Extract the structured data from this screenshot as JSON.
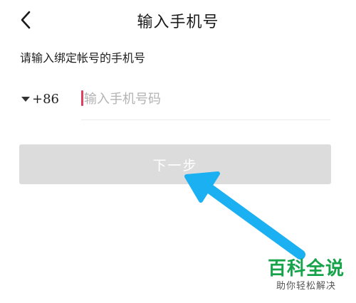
{
  "header": {
    "back_icon": "chevron-left-icon",
    "title": "输入手机号"
  },
  "form": {
    "subtitle": "请输入绑定帐号的手机号",
    "country_code": "+86",
    "country_dropdown_icon": "caret-down-icon",
    "phone_value": "",
    "phone_placeholder": "输入手机号码",
    "cursor_color": "#e0405f"
  },
  "actions": {
    "next_label": "下一步",
    "next_enabled": false,
    "next_bg_color": "#dcdcdc"
  },
  "overlay": {
    "arrow_color": "#1ab0f2",
    "arrow_icon": "pointer-arrow-icon"
  },
  "watermark": {
    "title": "百科全说",
    "subtitle": "助你轻松解决",
    "title_color": "#16a34a"
  }
}
